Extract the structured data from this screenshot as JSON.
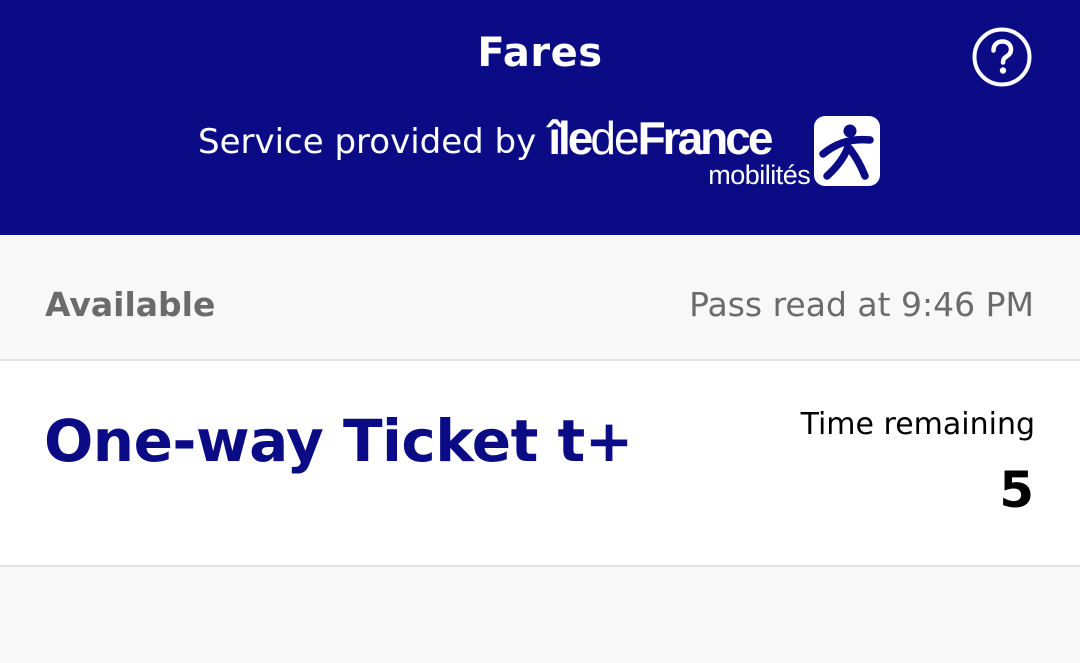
{
  "header": {
    "title": "Fares",
    "provider_prefix": "Service provided by",
    "brand": {
      "ile": "île",
      "de": "de",
      "france": "France",
      "sub": "mobilités"
    },
    "help_icon": "question-circle-icon",
    "logo_icon": "idfm-person-icon",
    "background_color": "#0b0b86"
  },
  "status": {
    "left": "Available",
    "right": "Pass read at 9:46 PM"
  },
  "ticket": {
    "name": "One-way Ticket t+",
    "time_label": "Time remaining",
    "time_value": "5",
    "name_color": "#0b0b86"
  }
}
